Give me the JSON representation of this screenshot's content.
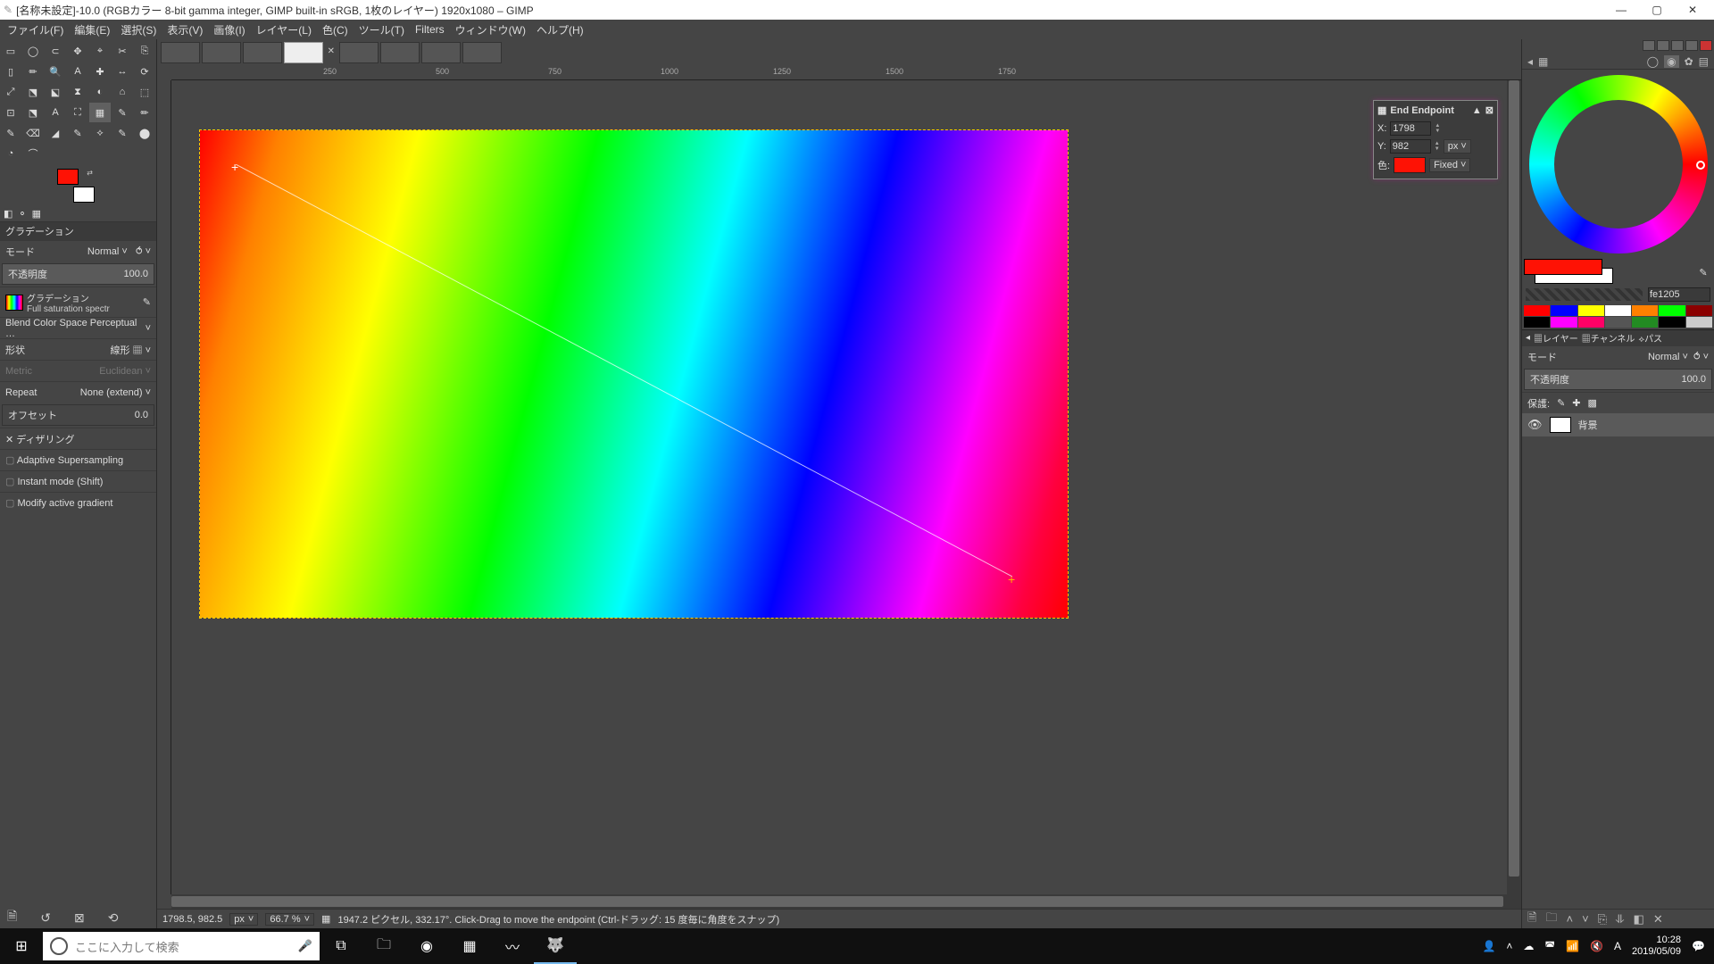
{
  "title": "[名称未設定]-10.0 (RGBカラー 8-bit gamma integer, GIMP built-in sRGB, 1枚のレイヤー) 1920x1080 – GIMP",
  "menu": [
    "ファイル(F)",
    "編集(E)",
    "選択(S)",
    "表示(V)",
    "画像(I)",
    "レイヤー(L)",
    "色(C)",
    "ツール(T)",
    "Filters",
    "ウィンドウ(W)",
    "ヘルプ(H)"
  ],
  "toolOptions": {
    "title": "グラデーション",
    "modeLabel": "モード",
    "modeValue": "Normal",
    "opacityLabel": "不透明度",
    "opacityValue": "100.0",
    "gradLabel": "グラデーション",
    "gradName": "Full saturation spectr",
    "blendLabel": "Blend Color Space Perceptual …",
    "shapeLabel": "形状",
    "shapeValue": "線形",
    "metricLabel": "Metric",
    "metricValue": "Euclidean",
    "repeatLabel": "Repeat",
    "repeatValue": "None (extend)",
    "offsetLabel": "オフセット",
    "offsetValue": "0.0",
    "ditherLabel": "ディザリング",
    "superLabel": "Adaptive Supersampling",
    "instantLabel": "Instant mode  (Shift)",
    "modifyLabel": "Modify active gradient"
  },
  "endpoint": {
    "title": "End Endpoint",
    "xLabel": "X:",
    "xValue": "1798",
    "yLabel": "Y:",
    "yValue": "982",
    "unit": "px",
    "colorLabel": "色:",
    "fixed": "Fixed"
  },
  "ruler": {
    "t250": "250",
    "t500": "500",
    "t750": "750",
    "t1000": "1000",
    "t1250": "1250",
    "t1500": "1500",
    "t1750": "1750"
  },
  "status": {
    "pos": "1798.5, 982.5",
    "unit": "px",
    "zoom": "66.7 %",
    "msg": "1947.2 ピクセル, 332.17°. Click-Drag to move the endpoint (Ctrl-ドラッグ: 15 度毎に角度をスナップ)"
  },
  "right": {
    "hex": "fe1205",
    "layersTab": "レイヤー",
    "channelsTab": "チャンネル",
    "pathsTab": "パス",
    "modeLabel": "モード",
    "modeValue": "Normal",
    "opacityLabel": "不透明度",
    "opacityValue": "100.0",
    "lockLabel": "保護:",
    "layerName": "背景"
  },
  "swatches": [
    "#ff0000",
    "#0000ff",
    "#ffff00",
    "#ffffff",
    "#ff8000",
    "#00ff00",
    "#8b0000",
    "#000000",
    "#ff00ff",
    "#ff0066",
    "#555555",
    "#228b22",
    "#000000",
    "#cccccc"
  ],
  "taskbar": {
    "searchPlaceholder": "ここに入力して検索",
    "time": "10:28",
    "date": "2019/05/09"
  }
}
